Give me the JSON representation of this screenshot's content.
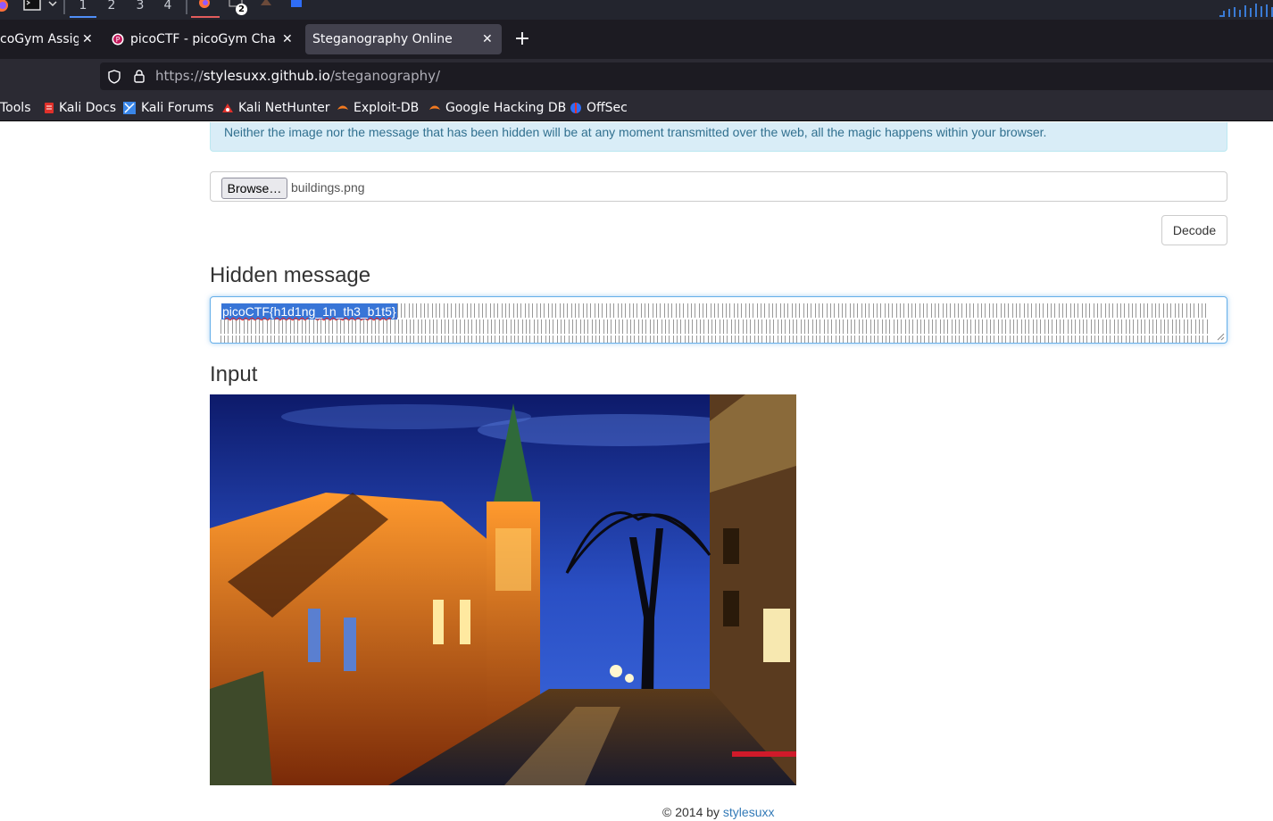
{
  "os_bar": {
    "workspaces": [
      "1",
      "2",
      "3",
      "4"
    ],
    "active_workspace": "1",
    "terminal_badge": "2"
  },
  "tabs": [
    {
      "title": "coGym Assignment",
      "active": false,
      "close": "✕"
    },
    {
      "title": "picoCTF - picoGym Challenges",
      "active": false,
      "close": "✕"
    },
    {
      "title": "Steganography Online",
      "active": true,
      "close": "✕"
    }
  ],
  "new_tab_label": "+",
  "address_bar": {
    "url_scheme": "https://",
    "url_host": "stylesuxx.github.io",
    "url_path": "/steganography/"
  },
  "bookmarks": [
    {
      "label": "Tools",
      "icon": "none"
    },
    {
      "label": "Kali Docs",
      "icon": "kali-docs-icon"
    },
    {
      "label": "Kali Forums",
      "icon": "kali-forums-icon"
    },
    {
      "label": "Kali NetHunter",
      "icon": "nethunter-icon"
    },
    {
      "label": "Exploit-DB",
      "icon": "exploit-db-icon"
    },
    {
      "label": "Google Hacking DB",
      "icon": "ghdb-icon"
    },
    {
      "label": "OffSec",
      "icon": "offsec-icon"
    }
  ],
  "page": {
    "alert_text": "Neither the image nor the message that has been hidden will be at any moment transmitted over the web, all the magic happens within your browser.",
    "browse_label": "Browse…",
    "file_name": "buildings.png",
    "decode_label": "Decode",
    "hidden_heading": "Hidden message",
    "hidden_message": "picoCTF{h1d1ng_1n_th3_b1t5}",
    "input_heading": "Input",
    "footer_prefix": "© 2014 by ",
    "footer_link": "stylesuxx"
  },
  "colors": {
    "accent": "#337ab7",
    "alert_bg": "#d9edf7",
    "alert_text": "#31708f",
    "selection": "#3875d7",
    "focus": "#66afe9"
  }
}
